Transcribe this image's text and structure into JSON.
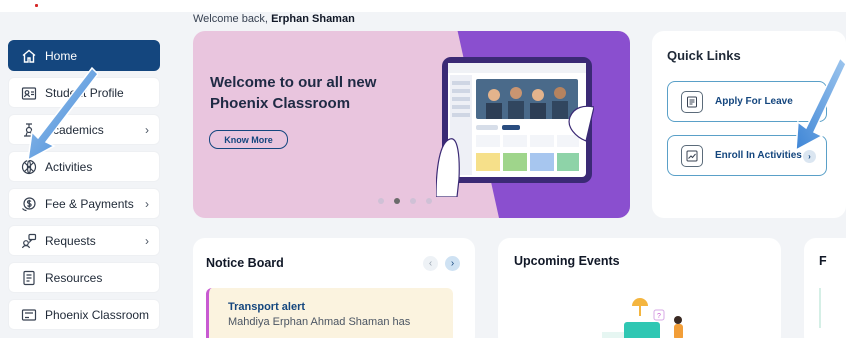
{
  "header": {
    "welcome_prefix": "Welcome back, ",
    "user_name": "Erphan Shaman"
  },
  "sidebar": {
    "items": [
      {
        "label": "Home",
        "icon": "home-icon",
        "active": true,
        "chevron": false
      },
      {
        "label": "Student Profile",
        "icon": "profile-card-icon",
        "active": false,
        "chevron": false
      },
      {
        "label": "Academics",
        "icon": "academics-icon",
        "active": false,
        "chevron": true
      },
      {
        "label": "Activities",
        "icon": "activities-ball-icon",
        "active": false,
        "chevron": false
      },
      {
        "label": "Fee & Payments",
        "icon": "fee-payments-icon",
        "active": false,
        "chevron": true
      },
      {
        "label": "Requests",
        "icon": "requests-icon",
        "active": false,
        "chevron": true
      },
      {
        "label": "Resources",
        "icon": "resources-icon",
        "active": false,
        "chevron": false
      },
      {
        "label": "Phoenix Classroom",
        "icon": "classroom-icon",
        "active": false,
        "chevron": false
      }
    ]
  },
  "banner": {
    "title": "Welcome to our all new Phoenix Classroom",
    "button_label": "Know More",
    "slides": 4,
    "active_slide": 2
  },
  "quick_links": {
    "title": "Quick Links",
    "items": [
      {
        "label": "Apply For Leave",
        "icon": "leave-form-icon"
      },
      {
        "label": "Enroll In Activities",
        "icon": "activity-chart-icon"
      }
    ]
  },
  "notice_board": {
    "title": "Notice Board",
    "alert_title": "Transport alert",
    "alert_text": "Mahdiya Erphan Ahmad Shaman has"
  },
  "upcoming_events": {
    "title": "Upcoming Events"
  },
  "third_card": {
    "title": "F"
  },
  "colors": {
    "brand": "#14467e",
    "banner_bg": "#e9c5de",
    "banner_purple": "#8a4fcf",
    "quick_link_border": "#5aa0c8",
    "alert_accent": "#c85ad2",
    "pointer_arrow": "#4a8fd9"
  }
}
